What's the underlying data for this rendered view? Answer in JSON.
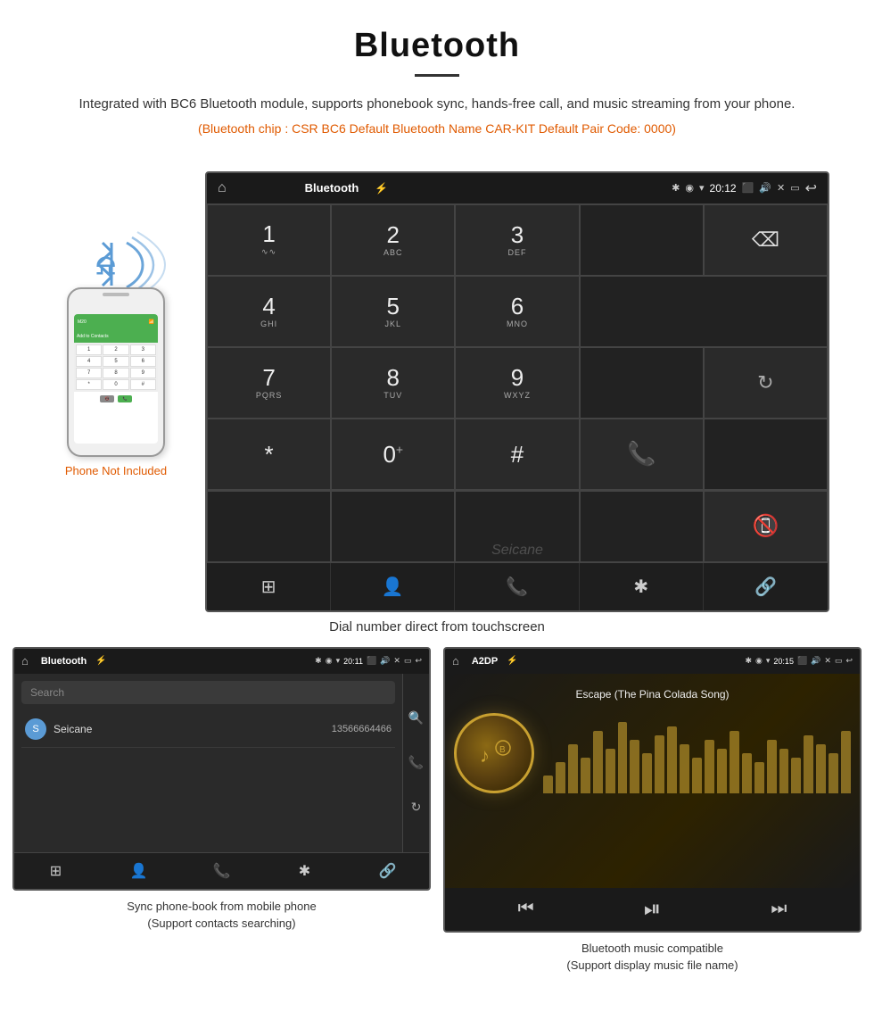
{
  "header": {
    "title": "Bluetooth",
    "description": "Integrated with BC6 Bluetooth module, supports phonebook sync, hands-free call, and music streaming from your phone.",
    "specs": "(Bluetooth chip : CSR BC6    Default Bluetooth Name CAR-KIT    Default Pair Code: 0000)"
  },
  "phone_note": "Phone Not Included",
  "dialpad": {
    "statusbar": {
      "left_icon": "🏠",
      "center": "Bluetooth",
      "usb_icon": "⚡",
      "bluetooth_icon": "✱",
      "location_icon": "◉",
      "wifi_icon": "▾",
      "time": "20:12",
      "camera_icon": "📷",
      "volume_icon": "🔊",
      "close_icon": "✕",
      "window_icon": "▭",
      "back_icon": "↩"
    },
    "keys": [
      {
        "digit": "1",
        "sub": "∿",
        "span": 1
      },
      {
        "digit": "2",
        "sub": "ABC",
        "span": 1
      },
      {
        "digit": "3",
        "sub": "DEF",
        "span": 1
      },
      {
        "digit": "",
        "sub": "",
        "span": 1,
        "empty": true
      },
      {
        "digit": "⌫",
        "sub": "",
        "span": 1,
        "special": "backspace"
      },
      {
        "digit": "4",
        "sub": "GHI",
        "span": 1
      },
      {
        "digit": "5",
        "sub": "JKL",
        "span": 1
      },
      {
        "digit": "6",
        "sub": "MNO",
        "span": 1
      },
      {
        "digit": "",
        "sub": "",
        "span": 2,
        "empty": true
      },
      {
        "digit": "7",
        "sub": "PQRS",
        "span": 1
      },
      {
        "digit": "8",
        "sub": "TUV",
        "span": 1
      },
      {
        "digit": "9",
        "sub": "WXYZ",
        "span": 1
      },
      {
        "digit": "",
        "sub": "",
        "span": 1,
        "empty": true
      },
      {
        "digit": "↻",
        "sub": "",
        "span": 1,
        "special": "refresh"
      },
      {
        "digit": "*",
        "sub": "",
        "span": 1
      },
      {
        "digit": "0",
        "sub": "+",
        "span": 1
      },
      {
        "digit": "#",
        "sub": "",
        "span": 1
      },
      {
        "digit": "📞",
        "sub": "",
        "span": 1,
        "special": "call-green"
      },
      {
        "digit": "",
        "sub": "",
        "span": 1,
        "empty": true
      },
      {
        "digit": "📵",
        "sub": "",
        "span": 1,
        "special": "call-red"
      }
    ],
    "nav": [
      "⊞",
      "👤",
      "📞",
      "✱",
      "🔗"
    ],
    "watermark": "Seicane"
  },
  "caption_main": "Dial number direct from touchscreen",
  "bottom_left": {
    "statusbar_title": "Bluetooth",
    "time": "20:11",
    "search_placeholder": "Search",
    "contact": {
      "letter": "S",
      "name": "Seicane",
      "phone": "13566664466"
    },
    "nav_icons": [
      "⊞",
      "👤",
      "📞",
      "✱",
      "🔗"
    ],
    "caption_line1": "Sync phone-book from mobile phone",
    "caption_line2": "(Support contacts searching)"
  },
  "bottom_right": {
    "statusbar_title": "A2DP",
    "time": "20:15",
    "song_title": "Escape (The Pina Colada Song)",
    "controls": [
      "⏮",
      "⏯",
      "⏭"
    ],
    "caption_line1": "Bluetooth music compatible",
    "caption_line2": "(Support display music file name)"
  },
  "equalizer_bars": [
    20,
    35,
    55,
    40,
    70,
    50,
    80,
    60,
    45,
    65,
    75,
    55,
    40,
    60,
    50,
    70,
    45,
    35,
    60,
    50,
    40,
    65,
    55,
    45,
    70
  ]
}
